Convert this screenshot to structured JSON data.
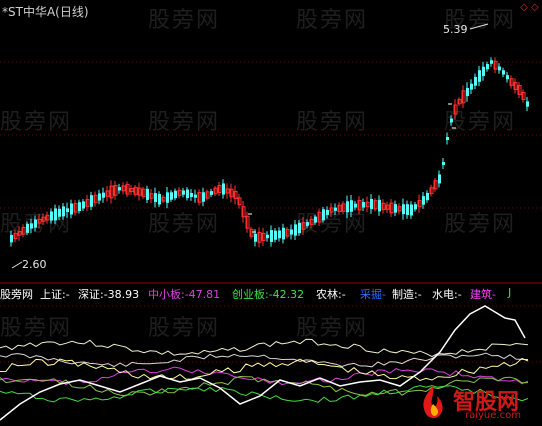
{
  "window": {
    "title": "*ST中华A(日线)",
    "watermark": "股旁网",
    "logo_brand": "智股网",
    "logo_url": "raiyue.com"
  },
  "price_chart": {
    "high_label": "5.39",
    "low_label": "2.60",
    "colors": {
      "up": "#ff3030",
      "down": "#54fcfc",
      "flat": "#ffffff"
    }
  },
  "indicator": {
    "items": [
      {
        "label": "股旁网",
        "value": "",
        "color": "#ffffff"
      },
      {
        "label": "上证:",
        "value": "-",
        "color": "#ffffff"
      },
      {
        "label": "深证:",
        "value": "-38.93",
        "color": "#ffffff"
      },
      {
        "label": "中小板:",
        "value": "-47.81",
        "color": "#e040e0"
      },
      {
        "label": "创业板:",
        "value": "-42.32",
        "color": "#40e040"
      },
      {
        "label": "农林:",
        "value": "-",
        "color": "#ffffff"
      },
      {
        "label": "采掘",
        "value": "-",
        "color": "#2a6cff"
      },
      {
        "label": "制造:",
        "value": "-",
        "color": "#ffffff"
      },
      {
        "label": "水电:",
        "value": "-",
        "color": "#ffffff"
      },
      {
        "label": "建筑",
        "value": "-",
        "color": "#ff40ff"
      },
      {
        "label": "J",
        "value": "",
        "color": "#40e040"
      }
    ]
  }
}
